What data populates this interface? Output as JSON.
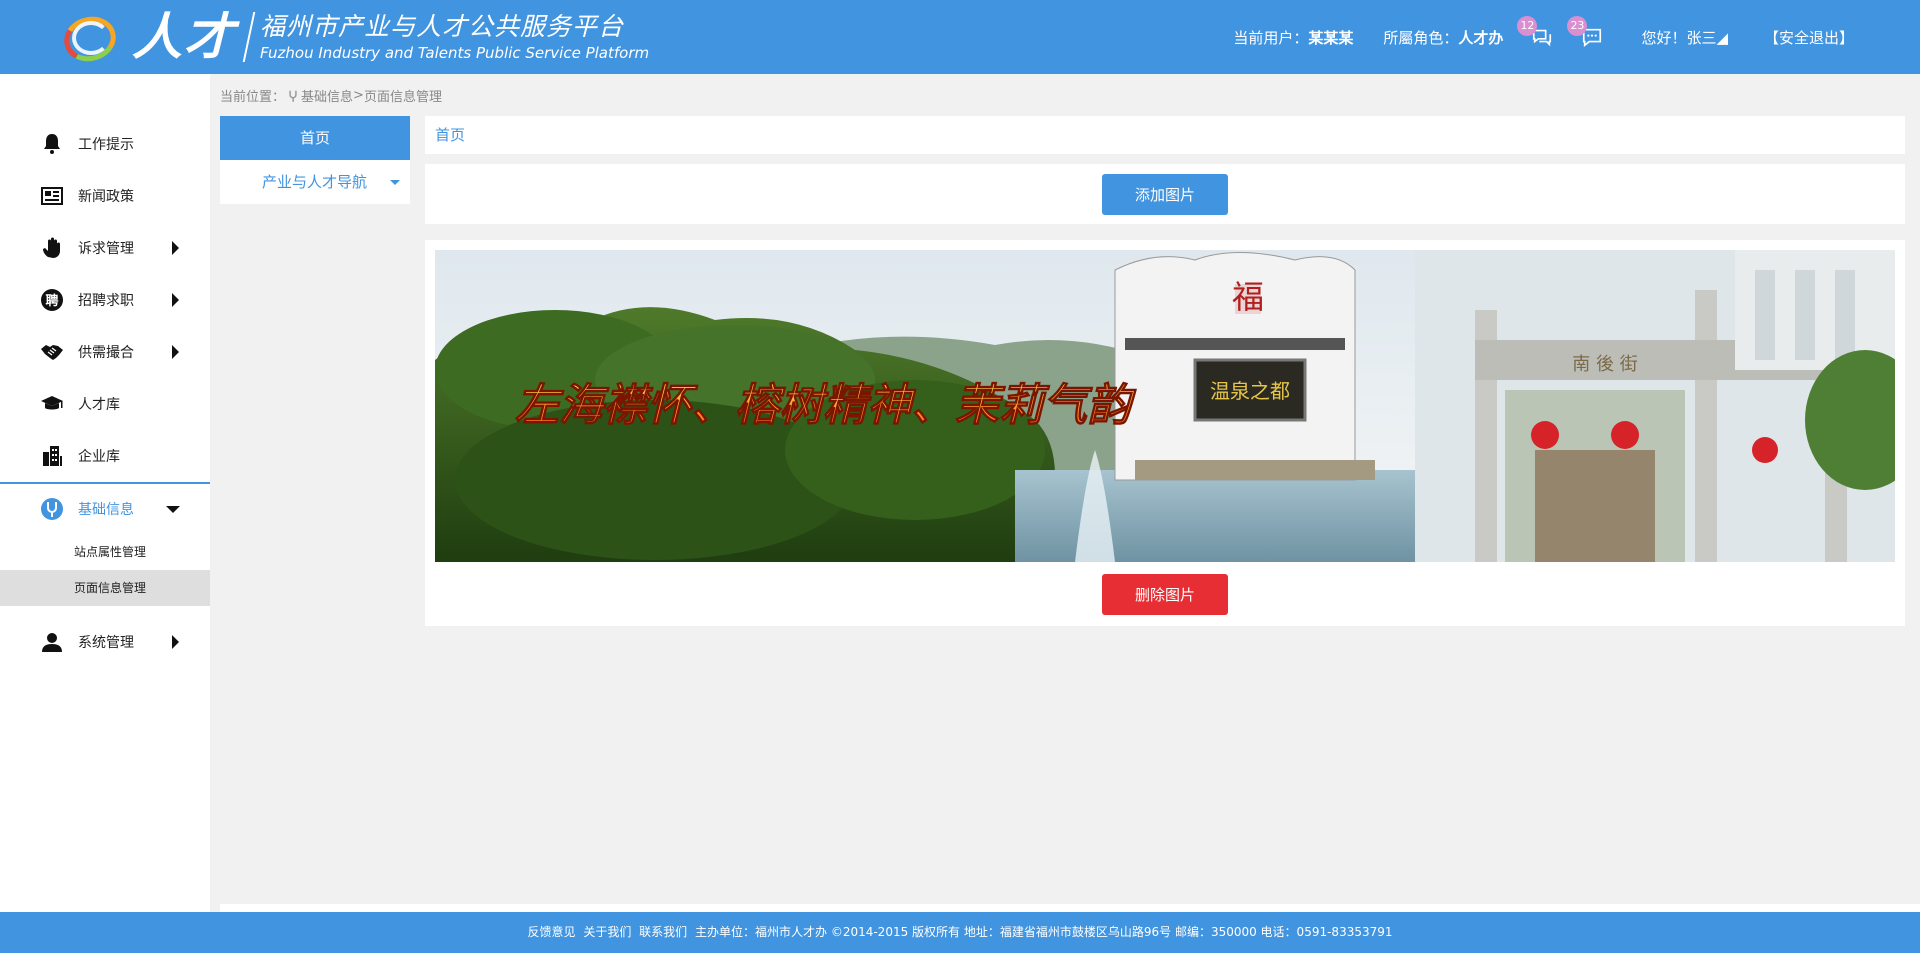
{
  "header": {
    "logo_big": "人才",
    "logo_cn": "福州市产业与人才公共服务平台",
    "logo_en": "Fuzhou Industry and Talents Public Service Platform",
    "current_user_label": "当前用户：",
    "current_user_value": "某某某",
    "role_label": "所屬角色：",
    "role_value": "人才办",
    "messages_badge": "12",
    "chat_badge": "23",
    "greeting": "您好！张三◢",
    "logout": "【安全退出】"
  },
  "sidebar": {
    "items": [
      {
        "label": "工作提示",
        "icon": "bell-icon"
      },
      {
        "label": "新闻政策",
        "icon": "newspaper-icon"
      },
      {
        "label": "诉求管理",
        "icon": "hand-icon"
      },
      {
        "label": "招聘求职",
        "icon": "recruit-icon"
      },
      {
        "label": "供需撮合",
        "icon": "handshake-icon"
      },
      {
        "label": "人才库",
        "icon": "graduation-cap-icon"
      },
      {
        "label": "企业库",
        "icon": "building-icon"
      },
      {
        "label": "基础信息",
        "icon": "power-plug-icon"
      },
      {
        "label": "系统管理",
        "icon": "user-icon"
      }
    ],
    "sub_items": [
      "站点属性管理",
      "页面信息管理"
    ]
  },
  "breadcrumb": {
    "prefix": "当前位置：",
    "level1": "基础信息",
    "separator": ">",
    "level2": "页面信息管理"
  },
  "subpanel": {
    "home": "首页",
    "nav": "产业与人才导航"
  },
  "main": {
    "title": "首页",
    "add_button": "添加图片",
    "delete_button": "删除图片",
    "banner_text": "左海襟怀、榕树精神、茉莉气韵",
    "banner_sign": "温泉之都",
    "banner_fu": "福",
    "banner_gate": "南 後 街"
  },
  "footer": {
    "links": [
      "反馈意见",
      "关于我们",
      "联系我们"
    ],
    "text": "主办单位：福州市人才办    ©2014-2015 版权所有   地址：福建省福州市鼓楼区乌山路96号    邮编：350000 电话：0591-83353791"
  },
  "colors": {
    "primary": "#4194e0",
    "danger": "#e62e34",
    "background": "#f1f1f1"
  }
}
